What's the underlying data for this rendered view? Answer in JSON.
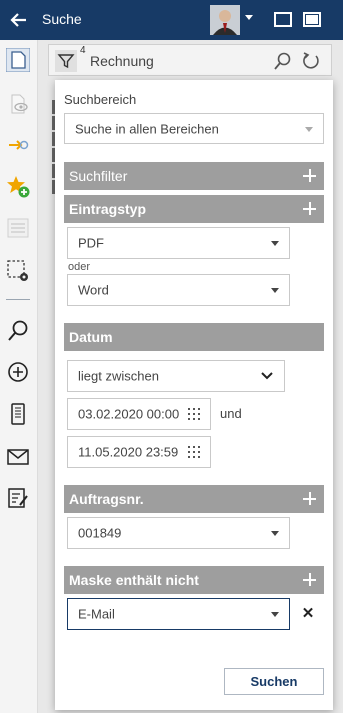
{
  "header": {
    "title": "Suche"
  },
  "searchbar": {
    "filter_count": "4",
    "query": "Rechnung"
  },
  "panel": {
    "suchbereich": {
      "label": "Suchbereich",
      "value": "Suche in allen Bereichen"
    },
    "suchfilter": {
      "title": "Suchfilter"
    },
    "eintragstyp": {
      "title": "Eintragstyp",
      "value1": "PDF",
      "connector": "oder",
      "value2": "Word"
    },
    "datum": {
      "title": "Datum",
      "operator": "liegt zwischen",
      "from": "03.02.2020 00:00",
      "and": "und",
      "to": "11.05.2020 23:59"
    },
    "auftragsnr": {
      "title": "Auftragsnr.",
      "value": "001849"
    },
    "maske": {
      "title": "Maske enthält nicht",
      "value": "E-Mail"
    },
    "submit": "Suchen"
  },
  "colors": {
    "header_bg": "#173a66",
    "section_bg": "#9e9e9e",
    "accent_star": "#f0a500",
    "accent_green": "#3aa83a"
  }
}
